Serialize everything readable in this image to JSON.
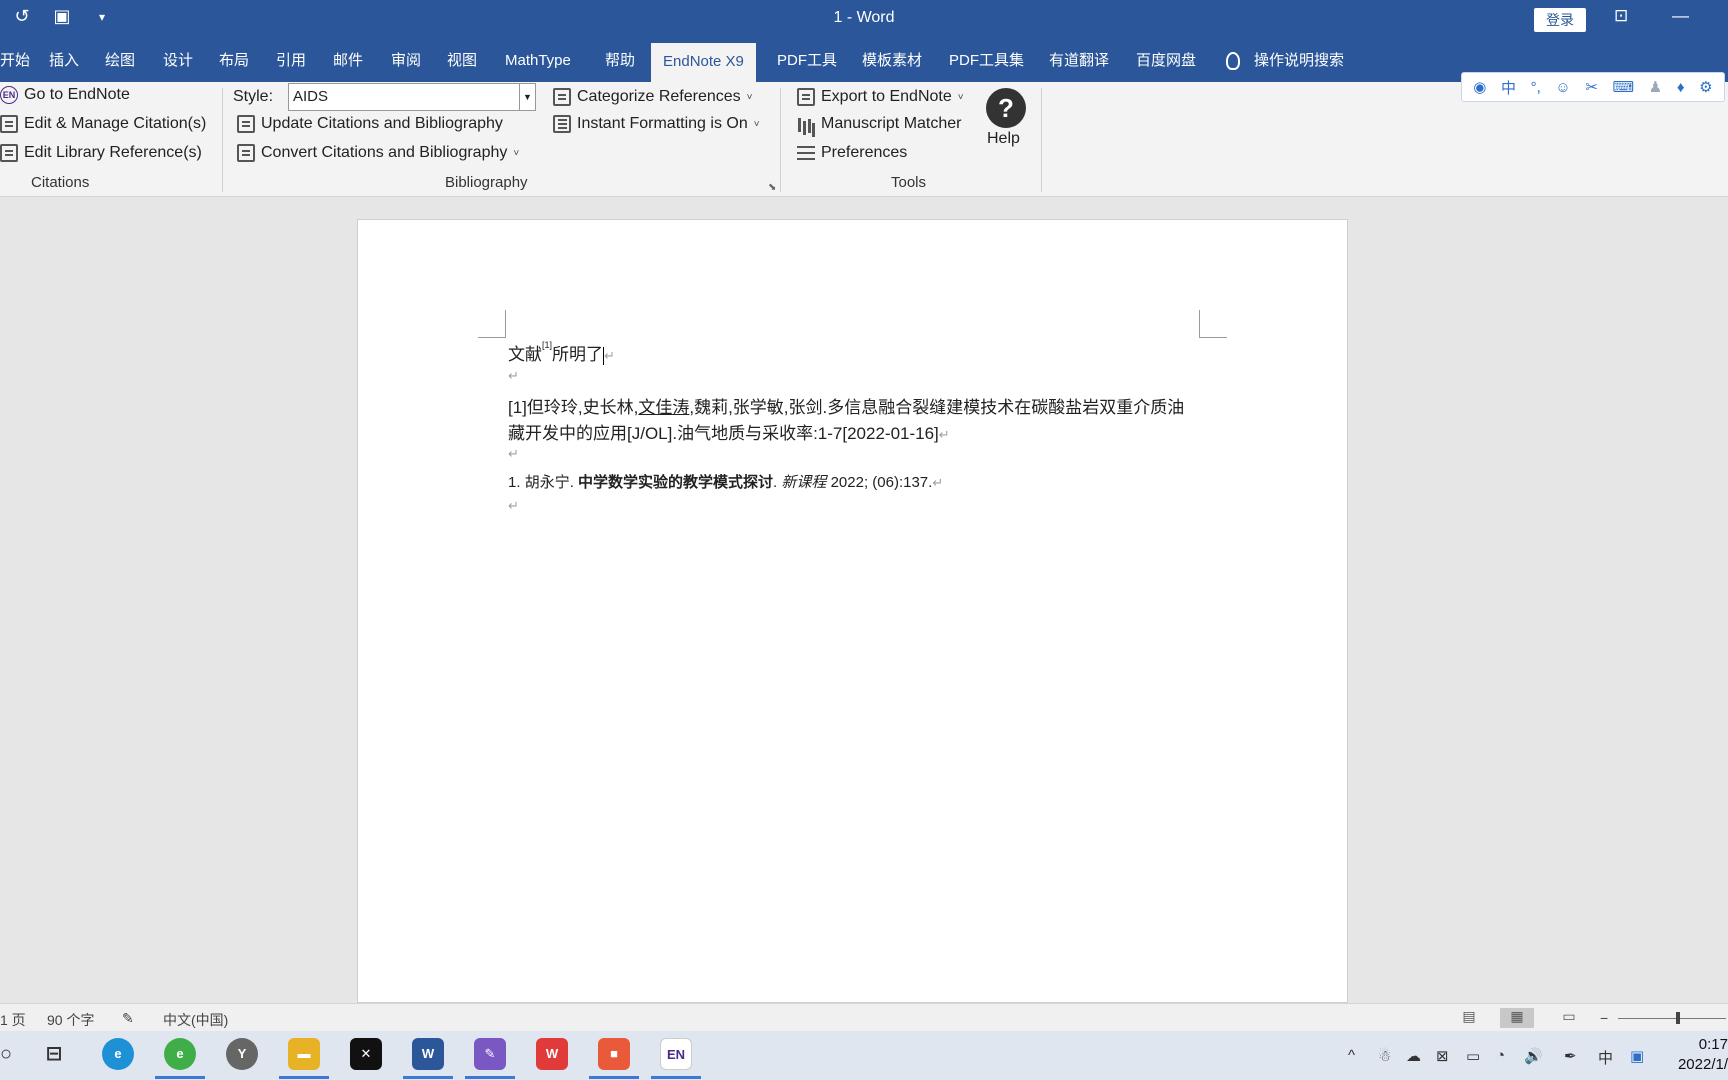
{
  "title_bar": {
    "title": "1  -  Word",
    "login": "登录",
    "restore_glyph": "⊡",
    "minimize_glyph": "—",
    "qat": [
      {
        "icon": "undo-icon",
        "glyph": "↺"
      },
      {
        "icon": "layout-icon",
        "glyph": "▣"
      },
      {
        "icon": "customize-qat-icon",
        "glyph": "▾"
      }
    ]
  },
  "tabs": {
    "items": [
      "开始",
      "插入",
      "绘图",
      "设计",
      "布局",
      "引用",
      "邮件",
      "审阅",
      "视图",
      "MathType",
      "帮助",
      "EndNote X9",
      "PDF工具",
      "模板素材",
      "PDF工具集",
      "有道翻译",
      "百度网盘"
    ],
    "active": "EndNote X9",
    "tell_me": "操作说明搜索"
  },
  "ribbon": {
    "citations": {
      "go_to_endnote": "Go to EndNote",
      "edit_manage": "Edit & Manage Citation(s)",
      "edit_library": "Edit Library Reference(s)",
      "group_label": "Citations"
    },
    "bibliography": {
      "style_label": "Style:",
      "style_value": "AIDS",
      "update": "Update Citations and Bibliography",
      "convert": "Convert Citations and Bibliography",
      "categorize": "Categorize References",
      "instant_formatting": "Instant Formatting is On",
      "group_label": "Bibliography"
    },
    "tools": {
      "export": "Export to EndNote",
      "manuscript_matcher": "Manuscript Matcher",
      "preferences": "Preferences",
      "help": "Help",
      "group_label": "Tools"
    }
  },
  "ime_toolbar": [
    {
      "icon": "ime-logo-icon",
      "glyph": "◉"
    },
    {
      "icon": "chinese-mode-icon",
      "glyph": "中"
    },
    {
      "icon": "punctuation-icon",
      "glyph": "°,"
    },
    {
      "icon": "emoji-icon",
      "glyph": "☺"
    },
    {
      "icon": "scissors-icon",
      "glyph": "✂"
    },
    {
      "icon": "keyboard-icon",
      "glyph": "⌨"
    },
    {
      "icon": "user-icon",
      "glyph": "♟"
    },
    {
      "icon": "skin-icon",
      "glyph": "♦"
    },
    {
      "icon": "settings-icon",
      "glyph": "⚙"
    }
  ],
  "document": {
    "line1_before": "文献",
    "line1_sup": "[1]",
    "line1_after": "所明了",
    "ref1_start": "[1]但玲玲,史长林,",
    "ref1_underlined": "文佳涛",
    "ref1_end": ",魏莉,张学敏,张剑.多信息融合裂缝建模技术在碳酸盐岩双重介质油",
    "ref1_line2": "藏开发中的应用[J/OL].油气地质与采收率:1-7[2022-01-16]",
    "ref2_num": "1.",
    "ref2_author": "胡永宁.",
    "ref2_title": "中学数学实验的教学模式探讨",
    "ref2_dot": ".",
    "ref2_journal": "新课程",
    "ref2_tail": "2022; (06):137.",
    "para_mark": "↵"
  },
  "status_bar": {
    "page": "1 页",
    "words": "90 个字",
    "language": "中文(中国)",
    "zoom_minus": "−"
  },
  "taskbar": {
    "start_glyph": "○",
    "apps": [
      {
        "name": "task-view",
        "glyph": "⊟"
      },
      {
        "name": "edge-blue",
        "glyph": "e"
      },
      {
        "name": "ie-green",
        "glyph": "e"
      },
      {
        "name": "clock-app",
        "glyph": "Y"
      },
      {
        "name": "file-explorer",
        "glyph": "▬"
      },
      {
        "name": "capcut",
        "glyph": "✕"
      },
      {
        "name": "word",
        "glyph": "W"
      },
      {
        "name": "paint-app",
        "glyph": "✎"
      },
      {
        "name": "wps",
        "glyph": "W"
      },
      {
        "name": "screen-recorder",
        "glyph": "■"
      },
      {
        "name": "endnote",
        "glyph": "EN"
      }
    ],
    "tray": [
      "^",
      "☃",
      "☁",
      "⊠",
      "▭",
      "◔",
      "🔊",
      "✒",
      "中",
      "▣"
    ],
    "time": "0:17",
    "date": "2022/1/"
  },
  "colors": {
    "word_blue": "#2b579a",
    "ribbon_bg": "#f3f3f3",
    "endnote_purple": "#4b2a87"
  }
}
